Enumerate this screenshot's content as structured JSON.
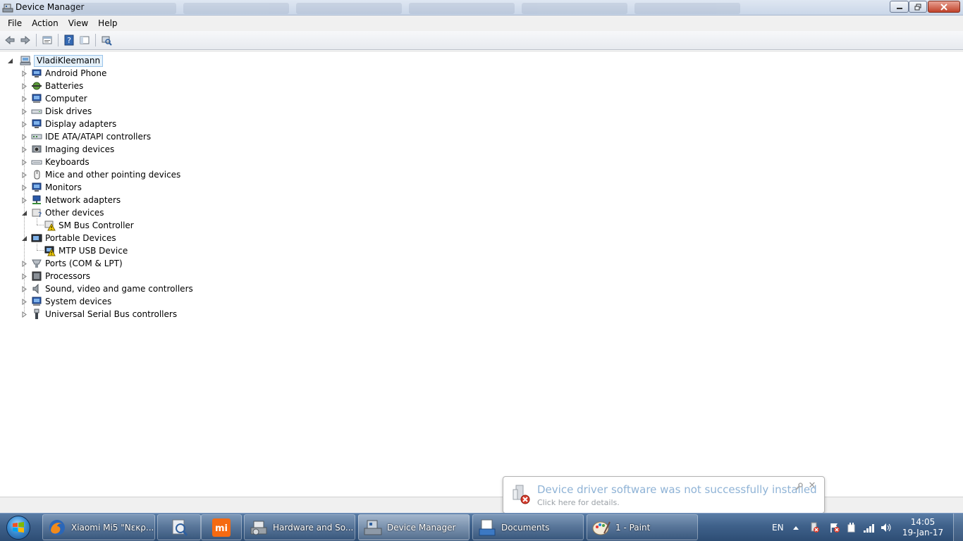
{
  "window": {
    "title": "Device Manager"
  },
  "menu": [
    "File",
    "Action",
    "View",
    "Help"
  ],
  "toolbar": {
    "buttons": [
      "back-arrow-icon",
      "forward-arrow-icon",
      "properties-icon",
      "help-icon",
      "show-hide-console-tree-icon",
      "scan-hardware-icon"
    ]
  },
  "tree": {
    "root": "VladiKleemann",
    "nodes": [
      {
        "label": "Android Phone",
        "icon": "android-phone-icon",
        "expanded": false
      },
      {
        "label": "Batteries",
        "icon": "battery-icon",
        "expanded": false
      },
      {
        "label": "Computer",
        "icon": "computer-icon",
        "expanded": false
      },
      {
        "label": "Disk drives",
        "icon": "disk-drive-icon",
        "expanded": false
      },
      {
        "label": "Display adapters",
        "icon": "display-adapter-icon",
        "expanded": false
      },
      {
        "label": "IDE ATA/ATAPI controllers",
        "icon": "ide-controller-icon",
        "expanded": false
      },
      {
        "label": "Imaging devices",
        "icon": "imaging-device-icon",
        "expanded": false
      },
      {
        "label": "Keyboards",
        "icon": "keyboard-icon",
        "expanded": false
      },
      {
        "label": "Mice and other pointing devices",
        "icon": "mouse-icon",
        "expanded": false
      },
      {
        "label": "Monitors",
        "icon": "monitor-icon",
        "expanded": false
      },
      {
        "label": "Network adapters",
        "icon": "network-adapter-icon",
        "expanded": false
      },
      {
        "label": "Other devices",
        "icon": "unknown-device-icon",
        "expanded": true,
        "children": [
          {
            "label": "SM Bus Controller",
            "icon": "warning-device-icon"
          }
        ]
      },
      {
        "label": "Portable Devices",
        "icon": "portable-device-icon",
        "expanded": true,
        "children": [
          {
            "label": "MTP USB Device",
            "icon": "warning-device-icon"
          }
        ]
      },
      {
        "label": "Ports (COM & LPT)",
        "icon": "port-icon",
        "expanded": false
      },
      {
        "label": "Processors",
        "icon": "processor-icon",
        "expanded": false
      },
      {
        "label": "Sound, video and game controllers",
        "icon": "speaker-icon",
        "expanded": false
      },
      {
        "label": "System devices",
        "icon": "system-device-icon",
        "expanded": false
      },
      {
        "label": "Universal Serial Bus controllers",
        "icon": "usb-icon",
        "expanded": false
      }
    ]
  },
  "taskbar": {
    "start_icon": "windows-start-icon",
    "buttons": [
      {
        "label": "Xiaomi Mi5 \"Nεκρ...",
        "icon": "firefox-icon"
      },
      {
        "label": "",
        "icon": "search-tool-icon"
      },
      {
        "label": "",
        "icon": "mi-logo-icon"
      },
      {
        "label": "Hardware and So...",
        "icon": "hardware-sound-icon"
      },
      {
        "label": "Device Manager",
        "icon": "device-manager-icon",
        "active": true
      },
      {
        "label": "Documents",
        "icon": "documents-icon"
      },
      {
        "label": "1 - Paint",
        "icon": "paint-icon"
      }
    ],
    "language": "EN",
    "clock": {
      "time": "14:05",
      "date": "19-Jan-17"
    }
  },
  "notification": {
    "title": "Device driver software was not successfully installed",
    "subtitle": "Click here for details."
  },
  "colors": {
    "selection_border": "#99c4ea",
    "selection_fill": "#e5f1fb",
    "taskbar": "#3f618a",
    "balloon_title": "#8fb3d6"
  }
}
